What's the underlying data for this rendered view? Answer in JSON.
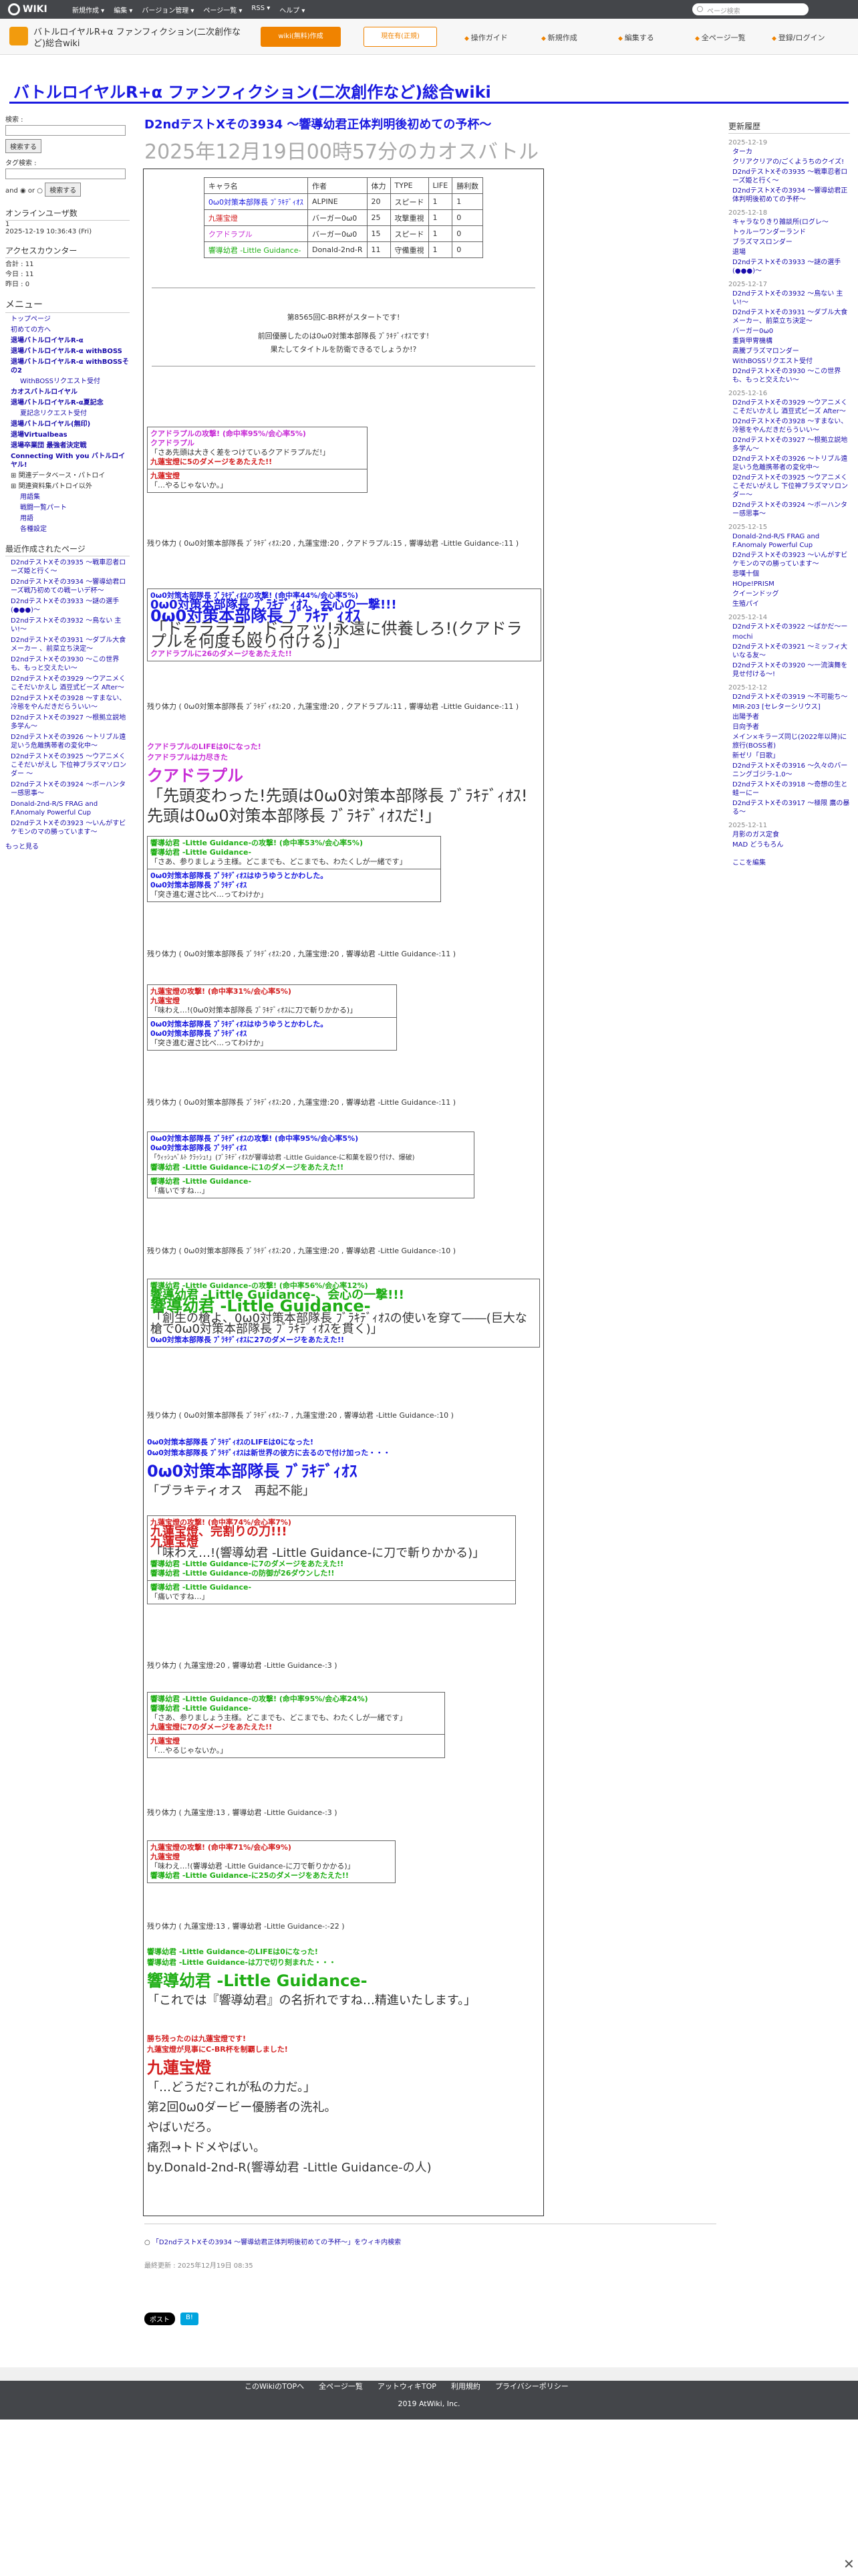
{
  "topbar": {
    "logo": "WIKI",
    "menu": [
      "新規作成 ▾",
      "編集 ▾",
      "バージョン管理 ▾",
      "ページ一覧 ▾",
      "RSS ▾",
      "ヘルプ ▾"
    ],
    "search_placeholder": "ページ検索"
  },
  "subbar": {
    "wiki_title": "バトルロイヤルR+α ファンフィクション(二次創作など)総合wiki",
    "btn_create": "wiki(無料)作成",
    "btn_ranking": "現在有(正規)",
    "tools": [
      "操作ガイド",
      "新規作成",
      "編集する",
      "全ページ一覧",
      "登録/ログイン"
    ]
  },
  "site_title": "バトルロイヤルR+α ファンフィクション(二次創作など)総合wiki",
  "sidebar": {
    "search_label": "検索 :",
    "search_btn": "検索する",
    "tag_label": "タグ検索 :",
    "and_or": "and ◉ or ○",
    "search_btn2": "検索する",
    "online_title": "オンラインユーザ数",
    "online_count": "1",
    "online_time": "2025-12-19 10:36:43 (Fri)",
    "counter_title": "アクセスカウンター",
    "counter_total": "合計 : 11",
    "counter_today": "今日 : 11",
    "counter_yesterday": "昨日 : 0",
    "menu_title": "メニュー",
    "menu_items": [
      "トップページ",
      "初めての方へ",
      "退場バトルロイヤルR-α",
      "退場バトルロイヤルR-α withBOSS",
      "退場バトルロイヤルR-α withBOSSその2",
      "WithBOSSリクエスト受付",
      "カオスバトルロイヤル",
      "退場バトルロイヤルR-α夏記念",
      "夏記念リクエスト受付",
      "退場バトルロイヤル(無印)",
      "退場Virtualbeas",
      "退場卒業団 最強者決定戦",
      "Connecting With you バトルロイヤル!",
      "関連データベース・パトロイ",
      "関連資料集パトロイ以外",
      "用語集",
      "戦闘一覧パート",
      "用語",
      "各種設定"
    ],
    "recent_title": "最近作成されたページ",
    "recent": [
      "D2ndテストXその3935 〜戦車忍者ローズ姫と行く〜",
      "D2ndテストXその3934 〜響導幼君ローズ戦乃初めての戦ーいデ杯〜",
      "D2ndテストXその3933 〜謎の選手 (●●●)〜",
      "D2ndテストXその3932 〜鳥ない 主い!〜",
      "D2ndテストXその3931 〜ダブル大食メーカー 、前菜立ち決定〜",
      "D2ndテストXその3930 〜この世界も、もっと交えたい〜",
      "D2ndテストXその3929 〜ウアニメくこそだいかえし 酒豆式ビーズ After〜",
      "D2ndテストXその3928 〜すまない、冷態をやんだきだらういい〜",
      "D2ndテストXその3927 〜根拠立説地多学ん〜",
      "D2ndテストXその3926 〜トリブル遠足いう危離携帯者の変化中〜",
      "D2ndテストXその3925 〜ウアニメくこそだいがえし 下位神ブラズマソロンダー 〜",
      "D2ndテストXその3924 〜ボーハンター感思事〜",
      "Donald-2nd-R/S FRAG and F.Anomaly Powerful Cup",
      "D2ndテストXその3923 〜いんがすビケモンのマの勝っています〜"
    ],
    "more": "もっと見る"
  },
  "main": {
    "title": "D2ndテストXその3934 〜響導幼君正体判明後初めての予杯〜",
    "subtitle": "2025年12月19日00時57分のカオスバトル"
  },
  "table": {
    "headers": [
      "キャラ名",
      "作者",
      "体力",
      "TYPE",
      "LIFE",
      "勝利数"
    ],
    "rows": [
      [
        "0ω0対策本部隊長 ﾌﾞﾗｷﾃﾞｨｵｽ",
        "ALPINE",
        "20",
        "スピード",
        "1",
        "1"
      ],
      [
        "九蓮宝燈",
        "バーガー0ω0",
        "25",
        "攻撃重視",
        "1",
        "0"
      ],
      [
        "クアドラプル",
        "バーガー0ω0",
        "15",
        "スピード",
        "1",
        "0"
      ],
      [
        "響導幼君 -Little Guidance-",
        "Donald-2nd-R",
        "11",
        "守備重視",
        "1",
        "0"
      ]
    ]
  },
  "intro": {
    "line1": "第8565回C-BR杯がスタートです!",
    "line2": "前回優勝したのは0ω0対策本部隊長 ﾌﾞﾗｷﾃﾞｨｵｽです!",
    "line3": "果たしてタイトルを防衛できるでしょうか!?"
  },
  "hp_lines": {
    "hp1": "残り体力 ( 0ω0対策本部隊長 ﾌﾞﾗｷﾃﾞｨｵｽ:20 , 九蓮宝燈:20 , クアドラプル:15 , 響導幼君 -Little Guidance-:11 )",
    "hp2": "残り体力 ( 0ω0対策本部隊長 ﾌﾞﾗｷﾃﾞｨｵｽ:20 , 九蓮宝燈:20 , クアドラプル:11 , 響導幼君 -Little Guidance-:11 )",
    "hp3": "残り体力 ( 0ω0対策本部隊長 ﾌﾞﾗｷﾃﾞｨｵｽ:20 , 九蓮宝燈:20 , 響導幼君 -Little Guidance-:11 )",
    "hp4": "残り体力 ( 0ω0対策本部隊長 ﾌﾞﾗｷﾃﾞｨｵｽ:20 , 九蓮宝燈:20 , 響導幼君 -Little Guidance-:11 )",
    "hp5": "残り体力 ( 0ω0対策本部隊長 ﾌﾞﾗｷﾃﾞｨｵｽ:20 , 九蓮宝燈:20 , 響導幼君 -Little Guidance-:10 )",
    "hp6": "残り体力 ( 0ω0対策本部隊長 ﾌﾞﾗｷﾃﾞｨｵｽ:-7 , 九蓮宝燈:20 , 響導幼君 -Little Guidance-:10 )",
    "hp7": "残り体力 ( 九蓮宝燈:20 , 響導幼君 -Little Guidance-:3 )",
    "hp8": "残り体力 ( 九蓮宝燈:13 , 響導幼君 -Little Guidance-:3 )",
    "hp9": "残り体力 ( 九蓮宝燈:13 , 響導幼君 -Little Guidance-:-22 )"
  },
  "battle": {
    "b1": [
      "クアドラプルの攻撃! (命中率95%/会心率5%)",
      "クアドラプル",
      "「さあ先頭は大きく差をつけているクアドラプルだ!」",
      "九蓮宝燈に5のダメージをあたえた!!",
      "九蓮宝燈",
      "「…やるじゃないか。」"
    ],
    "b2": [
      "0ω0対策本部隊長 ﾌﾞﾗｷﾃﾞｨｵｽの攻撃! (命中率44%/会心率5%)",
      "0ω0対策本部隊長 ﾌﾞﾗｷﾃﾞｨｵｽ、会心の一撃!!!",
      "0ω0対策本部隊長 ﾌﾞﾗｷﾃﾞｨｵｽ",
      "「ドララララ…ドラァッ!永遠に供養しろ!(クアドラプルを何度も殴り付ける)」",
      "クアドラプルに26のダメージをあたえた!!"
    ],
    "b3": [
      "クアドラプルのLIFEは0になった!",
      "クアドラプルは力尽きた",
      "クアドラプル",
      "「先頭変わった!先頭は0ω0対策本部隊長 ﾌﾞﾗｷﾃﾞｨｵｽ!先頭は0ω0対策本部隊長 ﾌﾞﾗｷﾃﾞｨｵｽだ!」"
    ],
    "b4": [
      "響導幼君 -Little Guidance-の攻撃! (命中率53%/会心率5%)",
      "響導幼君 -Little Guidance-",
      "「さあ、参りましょう主様。どこまでも、どこまでも、わたくしが一緒です」",
      "0ω0対策本部隊長 ﾌﾞﾗｷﾃﾞｨｵｽはゆうゆうとかわした。",
      "0ω0対策本部隊長 ﾌﾞﾗｷﾃﾞｨｵｽ",
      "「突き進む遅さ比べ…ってわけか」"
    ],
    "b5": [
      "九蓮宝燈の攻撃! (命中率31%/会心率5%)",
      "九蓮宝燈",
      "「味わえ…!(0ω0対策本部隊長 ﾌﾞﾗｷﾃﾞｨｵｽに刀で斬りかかる)」",
      "0ω0対策本部隊長 ﾌﾞﾗｷﾃﾞｨｵｽはゆうゆうとかわした。",
      "0ω0対策本部隊長 ﾌﾞﾗｷﾃﾞｨｵｽ",
      "「突き進む遅さ比べ…ってわけか」"
    ],
    "b6": [
      "0ω0対策本部隊長 ﾌﾞﾗｷﾃﾞｨｵｽの攻撃! (命中率95%/会心率5%)",
      "0ω0対策本部隊長 ﾌﾞﾗｷﾃﾞｨｵｽ",
      "「ｳｨｯｼｭﾍﾞﾙﾄ ｸﾗｯｼｭ!」(ﾌﾞﾗｷﾃﾞｨｵｽが響導幼君 -Little Guidance-に和菓を殴り付け、爆破)",
      "響導幼君 -Little Guidance-に1のダメージをあたえた!!",
      "響導幼君 -Little Guidance-",
      "「痛いですね…」"
    ],
    "b7": [
      "響導幼君 -Little Guidance-の攻撃! (命中率56%/会心率12%)",
      "響導幼君 -Little Guidance-、会心の一撃!!!",
      "響導幼君 -Little Guidance-",
      "「創生の槍よ、0ω0対策本部隊長 ﾌﾞﾗｷﾃﾞｨｵｽの使いを穿て――(巨大な槍で0ω0対策本部隊長 ﾌﾞﾗｷﾃﾞｨｵｽを貫く)」",
      "0ω0対策本部隊長 ﾌﾞﾗｷﾃﾞｨｵｽに27のダメージをあたえた!!"
    ],
    "b8": [
      "0ω0対策本部隊長 ﾌﾞﾗｷﾃﾞｨｵｽのLIFEは0になった!",
      "0ω0対策本部隊長 ﾌﾞﾗｷﾃﾞｨｵｽは新世界の彼方に去るので付け加った・・・",
      "0ω0対策本部隊長 ﾌﾞﾗｷﾃﾞｨｵｽ",
      "「ブラキティオス　再起不能」"
    ],
    "b9": [
      "九蓮宝燈の攻撃! (命中率74%/会心率7%)",
      "九蓮宝燈、完割りの刀!!!",
      "九蓮宝燈",
      "「味わえ…!(響導幼君 -Little Guidance-に刀で斬りかかる)」",
      "響導幼君 -Little Guidance-に7のダメージをあたえた!!",
      "響導幼君 -Little Guidance-の防御が26ダウンした!!",
      "響導幼君 -Little Guidance-",
      "「痛いですね…」"
    ],
    "b10": [
      "響導幼君 -Little Guidance-の攻撃! (命中率95%/会心率24%)",
      "響導幼君 -Little Guidance-",
      "「さあ、参りましょう主様。どこまでも、どこまでも、わたくしが一緒です」",
      "九蓮宝燈に7のダメージをあたえた!!",
      "九蓮宝燈",
      "「…やるじゃないか。」"
    ],
    "b11": [
      "九蓮宝燈の攻撃! (命中率71%/会心率9%)",
      "九蓮宝燈",
      "「味わえ…!(響導幼君 -Little Guidance-に刀で斬りかかる)」",
      "響導幼君 -Little Guidance-に25のダメージをあたえた!!"
    ],
    "b12": [
      "響導幼君 -Little Guidance-のLIFEは0になった!",
      "響導幼君 -Little Guidance-は刀で切り刻まれた・・・",
      "響導幼君 -Little Guidance-",
      "「これでは『響導幼君』の名折れですね…精進いたします。」"
    ],
    "end": [
      "勝ち残ったのは九蓮宝燈です!",
      "九蓮宝燈が見事にC-BR杯を制覇しました!",
      "九蓮宝燈",
      "「…どうだ?これが私の力だ。」",
      "第2回0ω0ダービー優勝者の洗礼。",
      "やばいだろ。",
      "痛烈→トドメやばい。",
      "by.Donald-2nd-R(響導幼君 -Little Guidance-の人)"
    ]
  },
  "after": {
    "edit_link": "「D2ndテストXその3934 〜響導幼君正体判明後初めての予杯〜」をウィキ内検索",
    "last_update": "最終更新 : 2025年12月19日 08:35",
    "post_btn": "ポスト",
    "share_btn": "B!"
  },
  "rightbar": {
    "title": "更新履歴",
    "groups": [
      {
        "date": "2025-12-19",
        "items": [
          "ターカ",
          "クリアクリアの/ごくようちのクイズ!",
          "D2ndテストXその3935 〜戦車忍者ローズ姫と行く〜",
          "D2ndテストXその3934 〜響導幼君正体判明後初めての予杯〜"
        ]
      },
      {
        "date": "2025-12-18",
        "items": [
          "キャラなりきり雑談所(ログレ〜",
          "トゥルーワンダーランド",
          "ブラズマスロンダー",
          "退場",
          "D2ndテストXその3933 〜謎の選手 (●●●)〜"
        ]
      },
      {
        "date": "2025-12-17",
        "items": [
          "D2ndテストXその3932 〜鳥ない 主い!〜",
          "D2ndテストXその3931 〜ダブル大食メーカー、前菜立ち決定〜",
          "バーガー0ω0",
          "重貨甲冑機構",
          "高騰ブラズマロンダー",
          "WithBOSSリクエスト受付",
          "D2ndテストXその3930 〜この世界も、もっと交えたい〜"
        ]
      },
      {
        "date": "2025-12-16",
        "items": [
          "D2ndテストXその3929 〜ウアニメくこそだいかえし 酒豆式ビーズ After〜",
          "D2ndテストXその3928 〜すまない、冷態をやんだきだらういい〜",
          "D2ndテストXその3927 〜根拠立説地多学ん〜",
          "D2ndテストXその3926 〜トリブル遠足いう危離携帯者の変化中〜",
          "D2ndテストXその3925 〜ウアニメくこそだいがえし 下位神ブラズマソロンダー〜",
          "D2ndテストXその3924 〜ボーハンター感思事〜"
        ]
      },
      {
        "date": "2025-12-15",
        "items": [
          "Donald-2nd-R/S FRAG and F.Anomaly Powerful Cup",
          "D2ndテストXその3923 〜いんがすビケモンのマの勝っています〜",
          "悲嘆十個",
          "HOpe!PRISM",
          "クイーンドッグ",
          "生殖パイ"
        ]
      },
      {
        "date": "2025-12-14",
        "items": [
          "D2ndテストXその3922 〜ばかだ〜ー",
          "mochi",
          "D2ndテストXその3921 〜ミッフィ大いなる友〜",
          "D2ndテストXその3920 〜一流演舞を見せ付ける〜!"
        ]
      },
      {
        "date": "2025-12-12",
        "items": [
          "D2ndテストXその3919 〜不可能ち〜",
          "MIR-203 [セレターシリウス]",
          "出陽予者",
          "日向予者",
          "メイン×キラーズ同じ(2022年以降)に旅行(BOSS者)",
          "新ゼリ「日歌」",
          "D2ndテストXその3916 〜久々のバーニングゴジラ-1.0〜",
          "D2ndテストXその3918 〜奇想の生と蛙ーにー",
          "D2ndテストXその3917 〜極限 鷹の暴る〜"
        ]
      },
      {
        "date": "2025-12-11",
        "items": [
          "月影のガス定食",
          "MAD どうもろん"
        ]
      }
    ],
    "more": "ここを編集"
  },
  "footer": {
    "links": [
      "このWikiのTOPへ",
      "全ページ一覧",
      "アットウィキTOP",
      "利用規約",
      "プライバシーポリシー"
    ],
    "copyright": "2019 AtWiki, Inc."
  }
}
